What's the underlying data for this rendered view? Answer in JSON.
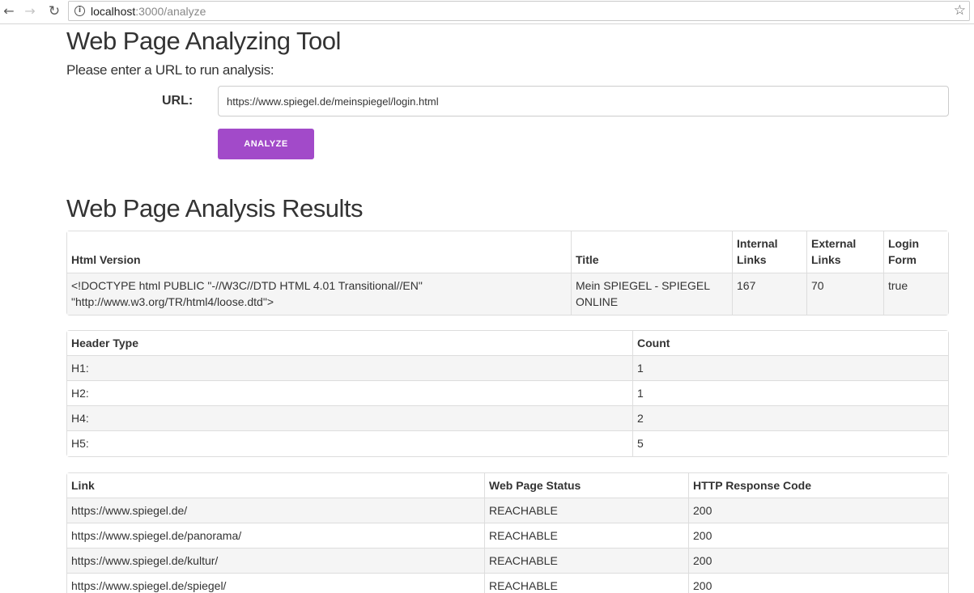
{
  "browser": {
    "url_host": "localhost",
    "url_path": ":3000/analyze"
  },
  "page": {
    "title": "Web Page Analyzing Tool",
    "prompt": "Please enter a URL to run analysis:",
    "url_label": "URL:",
    "url_value": "https://www.spiegel.de/meinspiegel/login.html",
    "analyze_label": "ANALYZE",
    "results_title": "Web Page Analysis Results"
  },
  "summary_table": {
    "headers": [
      "Html Version",
      "Title",
      "Internal Links",
      "External Links",
      "Login Form"
    ],
    "row": {
      "html_version": "<!DOCTYPE html PUBLIC \"-//W3C//DTD HTML 4.01 Transitional//EN\" \"http://www.w3.org/TR/html4/loose.dtd\">",
      "title": "Mein SPIEGEL - SPIEGEL ONLINE",
      "internal_links": "167",
      "external_links": "70",
      "login_form": "true"
    }
  },
  "headers_table": {
    "headers": [
      "Header Type",
      "Count"
    ],
    "rows": [
      {
        "type": "H1:",
        "count": "1"
      },
      {
        "type": "H2:",
        "count": "1"
      },
      {
        "type": "H4:",
        "count": "2"
      },
      {
        "type": "H5:",
        "count": "5"
      }
    ]
  },
  "links_table": {
    "headers": [
      "Link",
      "Web Page Status",
      "HTTP Response Code"
    ],
    "rows": [
      {
        "link": "https://www.spiegel.de/",
        "status": "REACHABLE",
        "code": "200"
      },
      {
        "link": "https://www.spiegel.de/panorama/",
        "status": "REACHABLE",
        "code": "200"
      },
      {
        "link": "https://www.spiegel.de/kultur/",
        "status": "REACHABLE",
        "code": "200"
      },
      {
        "link": "https://www.spiegel.de/spiegel/",
        "status": "REACHABLE",
        "code": "200"
      }
    ]
  },
  "colors": {
    "accent": "#a24ac9",
    "table_stripe": "#f5f5f5",
    "border": "#dddddd"
  }
}
